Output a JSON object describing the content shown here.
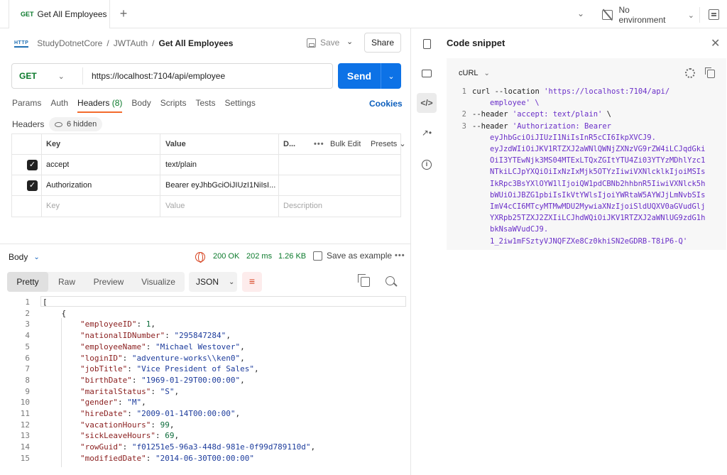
{
  "tabs": {
    "active": {
      "method": "GET",
      "name": "Get All Employees"
    },
    "new_tab_symbol": "+"
  },
  "environment": {
    "label": "No environment"
  },
  "breadcrumb": {
    "icon_text": "HTTP",
    "items": [
      "StudyDotnetCore",
      "JWTAuth"
    ],
    "separator": "/",
    "current": "Get All Employees"
  },
  "toolbar": {
    "save_label": "Save",
    "share_label": "Share"
  },
  "request": {
    "method": "GET",
    "url": "https://localhost:7104/api/employee",
    "send_label": "Send"
  },
  "request_tabs": [
    {
      "label": "Params",
      "active": false
    },
    {
      "label": "Auth",
      "active": false
    },
    {
      "label": "Headers",
      "count": "(8)",
      "active": true
    },
    {
      "label": "Body",
      "active": false
    },
    {
      "label": "Scripts",
      "active": false
    },
    {
      "label": "Tests",
      "active": false
    },
    {
      "label": "Settings",
      "active": false
    }
  ],
  "cookies_label": "Cookies",
  "headers_section": {
    "label": "Headers",
    "hidden_label": "6 hidden",
    "columns": {
      "key": "Key",
      "value": "Value",
      "description": "D...",
      "bulk_edit": "Bulk Edit",
      "presets": "Presets"
    },
    "rows": [
      {
        "checked": true,
        "key": "accept",
        "value": "text/plain",
        "description": ""
      },
      {
        "checked": true,
        "key": "Authorization",
        "value": "Bearer eyJhbGciOiJIUzI1NiIsI...",
        "description": ""
      }
    ],
    "placeholder": {
      "key": "Key",
      "value": "Value",
      "description": "Description"
    }
  },
  "response": {
    "body_label": "Body",
    "status": "200 OK",
    "time": "202 ms",
    "size": "1.26 KB",
    "save_example_label": "Save as example",
    "view_tabs": [
      {
        "label": "Pretty",
        "active": true
      },
      {
        "label": "Raw",
        "active": false
      },
      {
        "label": "Preview",
        "active": false
      },
      {
        "label": "Visualize",
        "active": false
      }
    ],
    "format": "JSON",
    "lines": [
      {
        "n": "1",
        "indent": "",
        "key": "",
        "value": "[",
        "vtype": "p",
        "comma": false
      },
      {
        "n": "2",
        "indent": "    ",
        "key": "",
        "value": "{",
        "vtype": "p",
        "comma": false
      },
      {
        "n": "3",
        "indent": "        ",
        "key": "\"employeeID\"",
        "value": "1",
        "vtype": "n",
        "comma": true
      },
      {
        "n": "4",
        "indent": "        ",
        "key": "\"nationalIDNumber\"",
        "value": "\"295847284\"",
        "vtype": "s",
        "comma": true
      },
      {
        "n": "5",
        "indent": "        ",
        "key": "\"employeeName\"",
        "value": "\"Michael Westover\"",
        "vtype": "s",
        "comma": true
      },
      {
        "n": "6",
        "indent": "        ",
        "key": "\"loginID\"",
        "value": "\"adventure-works\\\\ken0\"",
        "vtype": "s",
        "comma": true
      },
      {
        "n": "7",
        "indent": "        ",
        "key": "\"jobTitle\"",
        "value": "\"Vice President of Sales\"",
        "vtype": "s",
        "comma": true
      },
      {
        "n": "8",
        "indent": "        ",
        "key": "\"birthDate\"",
        "value": "\"1969-01-29T00:00:00\"",
        "vtype": "s",
        "comma": true
      },
      {
        "n": "9",
        "indent": "        ",
        "key": "\"maritalStatus\"",
        "value": "\"S\"",
        "vtype": "s",
        "comma": true
      },
      {
        "n": "10",
        "indent": "        ",
        "key": "\"gender\"",
        "value": "\"M\"",
        "vtype": "s",
        "comma": true
      },
      {
        "n": "11",
        "indent": "        ",
        "key": "\"hireDate\"",
        "value": "\"2009-01-14T00:00:00\"",
        "vtype": "s",
        "comma": true
      },
      {
        "n": "12",
        "indent": "        ",
        "key": "\"vacationHours\"",
        "value": "99",
        "vtype": "n",
        "comma": true
      },
      {
        "n": "13",
        "indent": "        ",
        "key": "\"sickLeaveHours\"",
        "value": "69",
        "vtype": "n",
        "comma": true
      },
      {
        "n": "14",
        "indent": "        ",
        "key": "\"rowGuid\"",
        "value": "\"f01251e5-96a3-448d-981e-0f99d789110d\"",
        "vtype": "s",
        "comma": true
      },
      {
        "n": "15",
        "indent": "        ",
        "key": "\"modifiedDate\"",
        "value": "\"2014-06-30T00:00:00\"",
        "vtype": "s",
        "comma": false
      }
    ]
  },
  "code_snippet": {
    "title": "Code snippet",
    "language": "cURL",
    "lines": [
      {
        "n": "1",
        "parts": [
          {
            "t": "curl --location ",
            "c": "p"
          },
          {
            "t": "'https://localhost:7104/api/",
            "c": "s"
          }
        ],
        "cont": [
          "employee' \\"
        ]
      },
      {
        "n": "2",
        "parts": [
          {
            "t": "--header ",
            "c": "p"
          },
          {
            "t": "'accept: text/plain'",
            "c": "s"
          },
          {
            "t": " \\",
            "c": "p"
          }
        ],
        "cont": []
      },
      {
        "n": "3",
        "parts": [
          {
            "t": "--header ",
            "c": "p"
          },
          {
            "t": "'Authorization: Bearer",
            "c": "s"
          }
        ],
        "cont": [
          "eyJhbGciOiJIUzI1NiIsInR5cCI6IkpXVCJ9.",
          "eyJzdWIiOiJKV1RTZXJ2aWNlQWNjZXNzVG9rZW4iLCJqdGki",
          "OiI3YTEwNjk3MS04MTExLTQxZGItYTU4Zi03YTYzMDhlYzc1",
          "NTkiLCJpYXQiOiIxNzIxMjk5OTYzIiwiVXNlcklkIjoiMSIs",
          "IkRpc3BsYXlOYW1lIjoiQW1pdCBNb2hhbnR5IiwiVXNlck5h",
          "bWUiOiJBZG1pbiIsIkVtYWlsIjoiYWRtaW5AYWJjLmNvbSIs",
          "ImV4cCI6MTcyMTMwMDU2MywiaXNzIjoiSldUQXV0aGVudGlj",
          "YXRpb25TZXJ2ZXIiLCJhdWQiOiJKV1RTZXJ2aWNlUG9zdG1h",
          "bkNsaWVudCJ9.",
          "1_2iw1mFSztyVJNQFZXe8Cz0khiSN2eGDRB-T8iP6-Q'"
        ]
      }
    ]
  }
}
